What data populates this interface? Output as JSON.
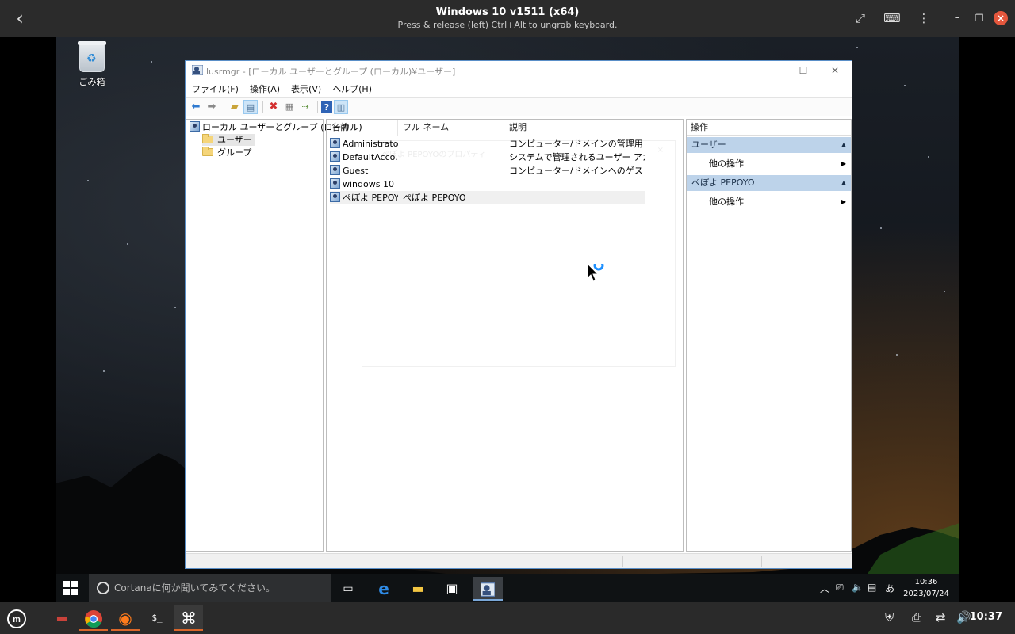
{
  "host": {
    "title": "Windows 10 v1511 (x64)",
    "subtitle": "Press & release (left) Ctrl+Alt to ungrab keyboard.",
    "time": "10:37",
    "icons": [
      "back-icon",
      "fullscreen-icon",
      "keyboard-icon",
      "menu-icon",
      "minimize-icon",
      "restore-icon",
      "close-icon"
    ]
  },
  "desktop": {
    "recycle_bin_label": "ごみ箱"
  },
  "mmc": {
    "title": "lusrmgr - [ローカル ユーザーとグループ (ローカル)¥ユーザー]",
    "menu": [
      "ファイル(F)",
      "操作(A)",
      "表示(V)",
      "ヘルプ(H)"
    ],
    "tree": {
      "root": "ローカル ユーザーとグループ (ローカル)",
      "children": [
        "ユーザー",
        "グループ"
      ]
    },
    "columns": [
      "名前",
      "フル ネーム",
      "説明"
    ],
    "rows": [
      {
        "name": "Administrator",
        "fullname": "",
        "description": "コンピューター/ドメインの管理用 (ビルト..."
      },
      {
        "name": "DefaultAcco...",
        "fullname": "",
        "description": "システムで管理されるユーザー アカウン..."
      },
      {
        "name": "Guest",
        "fullname": "",
        "description": "コンピューター/ドメインへのゲスト アクセ..."
      },
      {
        "name": "windows 10",
        "fullname": "",
        "description": ""
      },
      {
        "name": "ぺぽよ PEPOYO",
        "fullname": "ぺぽよ PEPOYO",
        "description": ""
      }
    ],
    "actions": {
      "header": "操作",
      "section1": "ユーザー",
      "section1_item": "他の操作",
      "section2": "ぺぽよ PEPOYO",
      "section2_item": "他の操作"
    },
    "ghost_text": "ぺぽよ PEPOYOのプロパティ"
  },
  "taskbar": {
    "cortana_placeholder": "Cortanaに何か聞いてみてください。",
    "time": "10:36",
    "date": "2023/07/24",
    "ime": "あ"
  },
  "colors": {
    "accent": "#5a8fc8",
    "action_section": "#bdd3ea",
    "host_close": "#e4573d",
    "host_active": "#d9662a"
  }
}
